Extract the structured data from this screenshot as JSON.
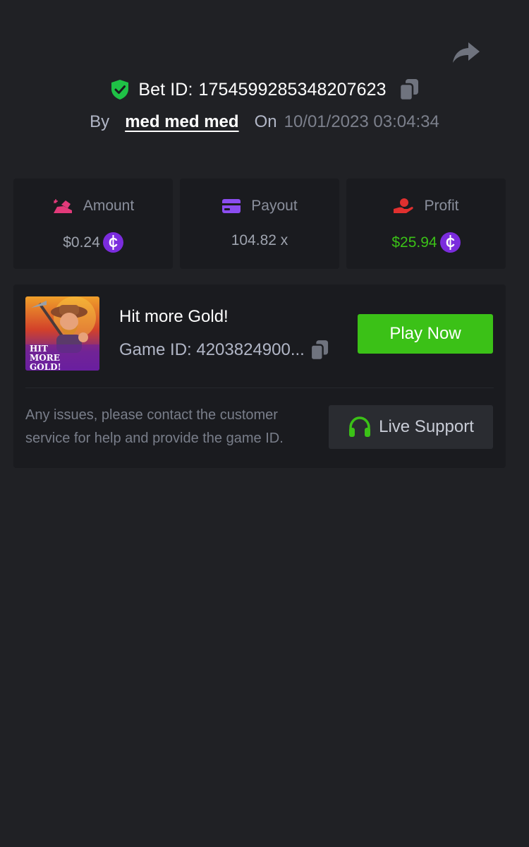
{
  "bet": {
    "id_label": "Bet ID:",
    "id_value": "1754599285348207623"
  },
  "meta": {
    "by_label": "By",
    "user": "med med med",
    "on_label": "On",
    "date": "10/01/2023 03:04:34"
  },
  "stats": [
    {
      "label": "Amount",
      "value": "$0.24",
      "icon": "amount-icon",
      "color": "#e23a7a"
    },
    {
      "label": "Payout",
      "value": "104.82 x",
      "icon": "card-icon",
      "color": "#8b4df0"
    },
    {
      "label": "Profit",
      "value": "$25.94",
      "icon": "hand-coin-icon",
      "color": "#e0302f",
      "value_color": "#3bc117"
    }
  ],
  "game": {
    "title": "Hit more Gold!",
    "id_text": "Game ID: 4203824900...",
    "thumb_text": "HIT MORE GOLD!",
    "play_label": "Play Now"
  },
  "support": {
    "help_text": "Any issues, please contact the customer service for help and provide the game ID.",
    "button_label": "Live Support"
  },
  "colors": {
    "background": "#202125",
    "card": "#1a1b1f",
    "accent_green": "#3bc117",
    "coin_purple": "#7b2cdd"
  }
}
